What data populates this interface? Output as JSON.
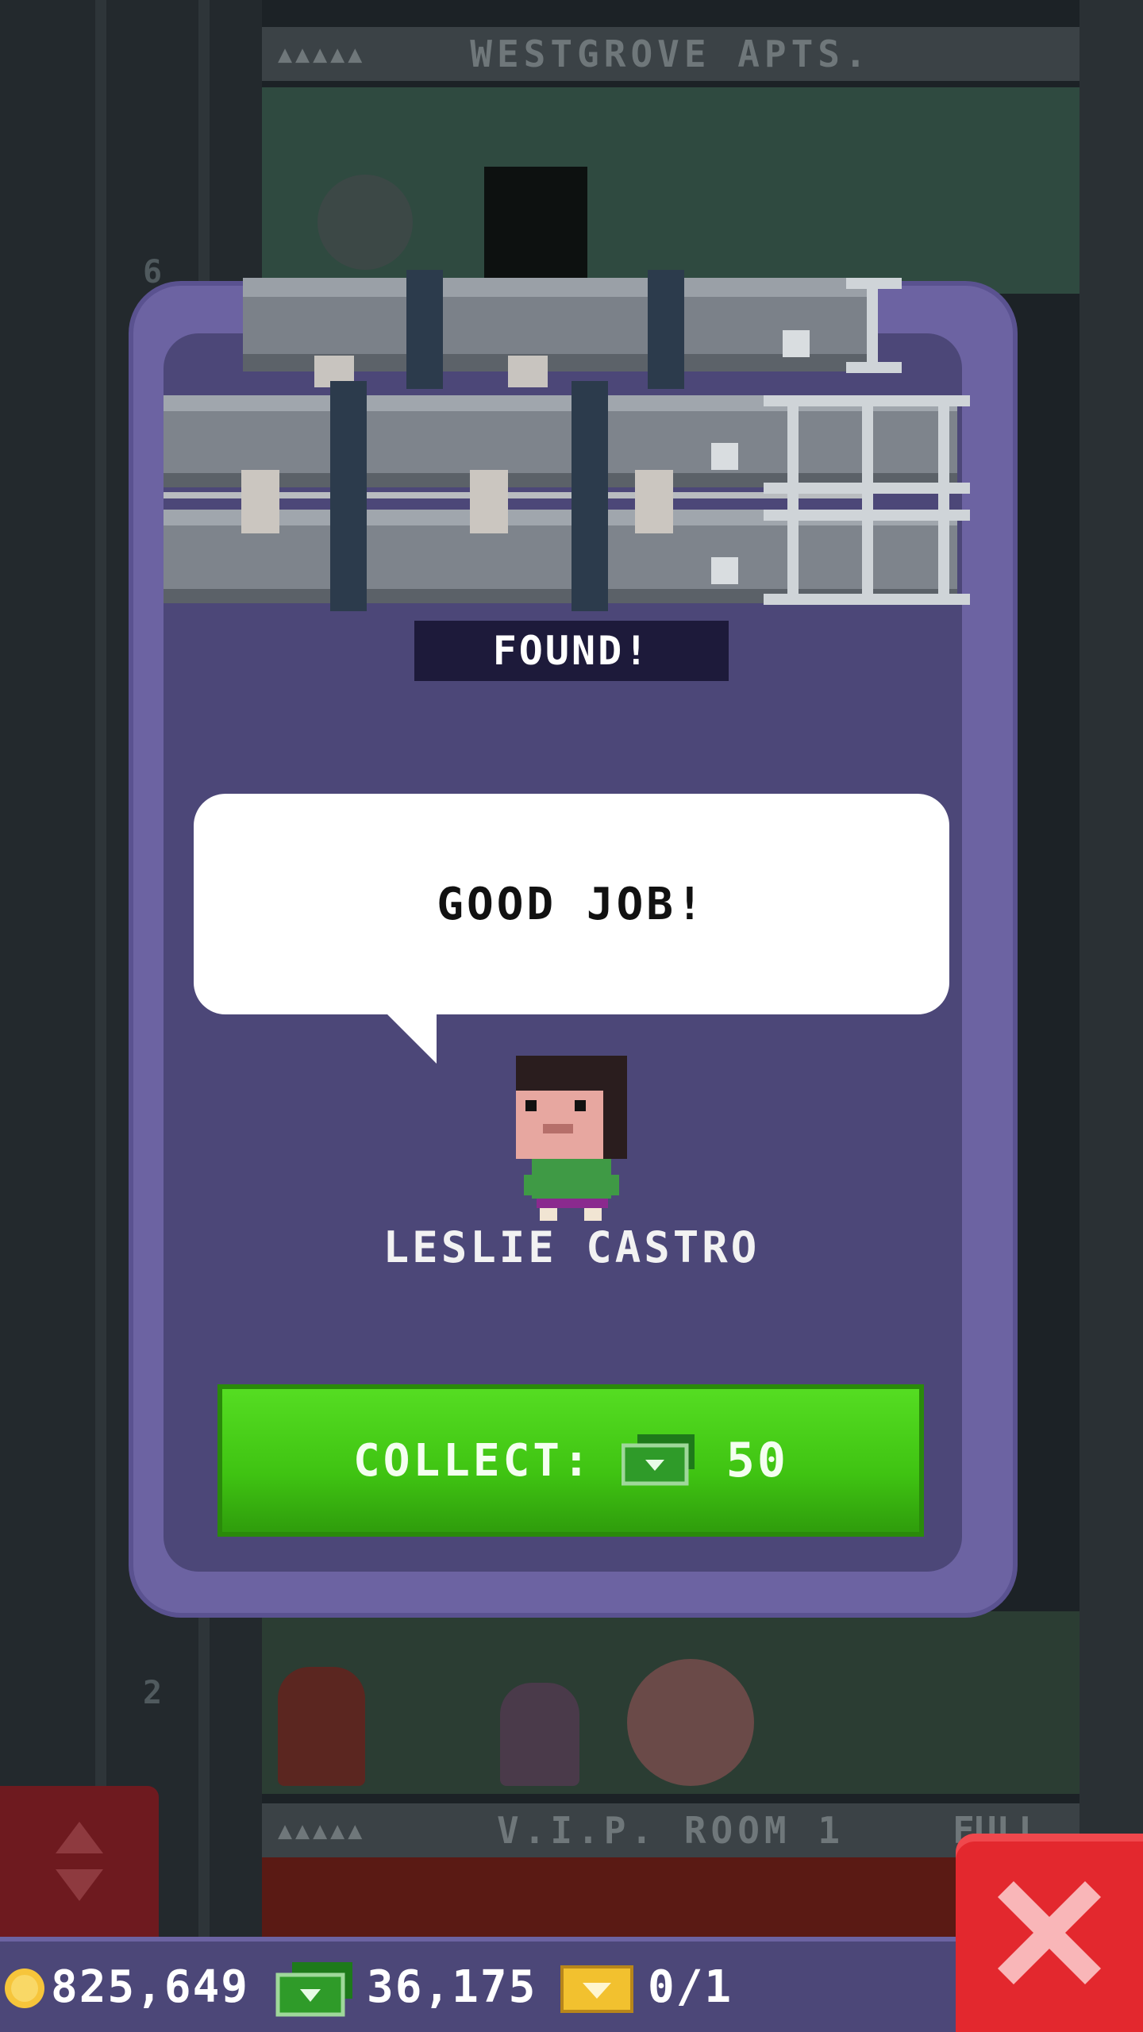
{
  "background": {
    "top_floor_label": "WESTGROVE APTS.",
    "bottom_floor_label": "V.I.P. ROOM 1",
    "bottom_floor_status": "FULL",
    "shaft_floor_numbers": [
      "6",
      "2"
    ]
  },
  "modal": {
    "status_label": "FOUND!",
    "speech_text": "GOOD JOB!",
    "character_name": "LESLIE CASTRO",
    "collect_label": "COLLECT:",
    "collect_amount": "50",
    "collect_currency_icon": "bux-icon"
  },
  "status_bar": {
    "coins": "825,649",
    "bux": "36,175",
    "tickets": "0/1"
  },
  "colors": {
    "modal_frame": "#6c63a2",
    "modal_body": "#4c4778",
    "collect_green": "#45c816",
    "close_red": "#e3282e"
  }
}
